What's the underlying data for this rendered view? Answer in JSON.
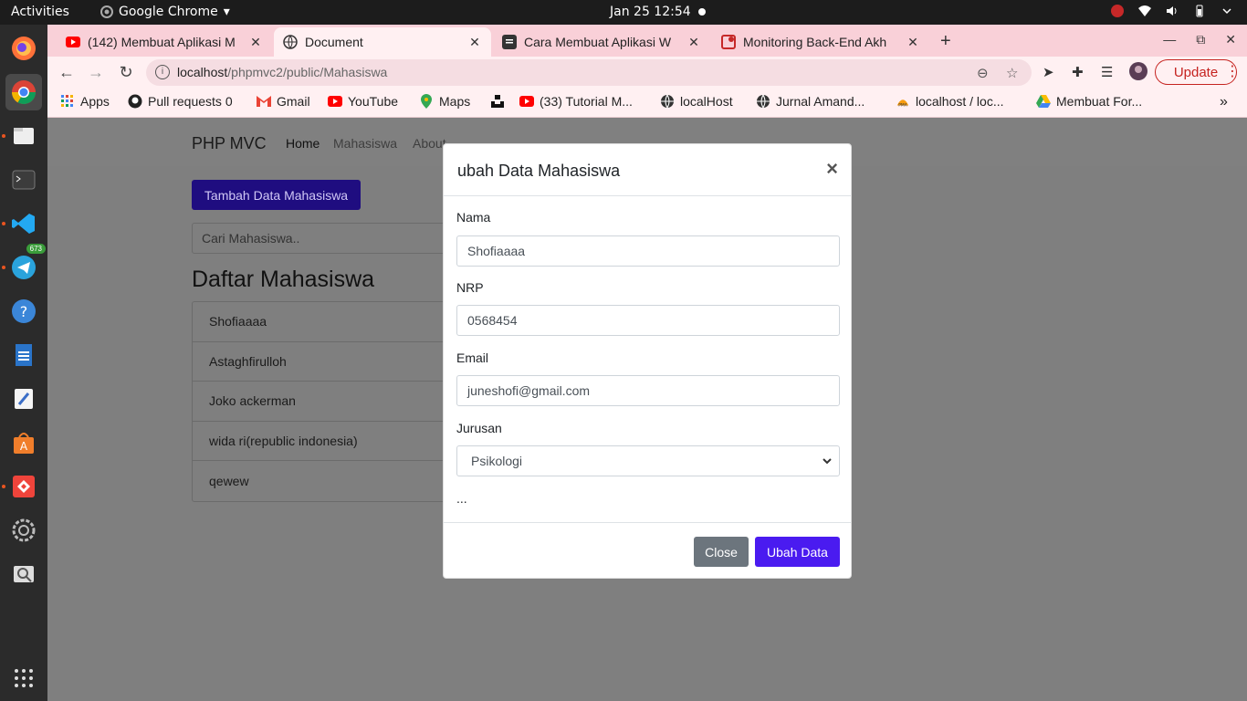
{
  "system": {
    "activities": "Activities",
    "app_name": "Google Chrome",
    "clock": "Jan 25  12:54"
  },
  "dock": {
    "telegram_badge": "673",
    "icons": [
      "firefox-icon",
      "chrome-icon",
      "files-icon",
      "terminal-icon",
      "vscode-icon",
      "telegram-icon",
      "help-icon",
      "libreoffice-writer-icon",
      "text-editor-icon",
      "software-center-icon",
      "anydesk-icon",
      "settings-icon",
      "screenshot-icon",
      "show-apps-icon"
    ]
  },
  "browser": {
    "tabs": [
      {
        "title": "(142) Membuat Aplikasi M",
        "icon": "youtube-icon"
      },
      {
        "title": "Document",
        "icon": "globe-icon",
        "active": true
      },
      {
        "title": "Cara Membuat Aplikasi W",
        "icon": "doc-icon"
      },
      {
        "title": "Monitoring Back-End Akh",
        "icon": "pinned-icon"
      }
    ],
    "url_host": "localhost",
    "url_path": "/phpmvc2/public/Mahasiswa",
    "update_label": "Update",
    "bookmarks": [
      {
        "label": "Apps",
        "icon": "apps-grid-icon"
      },
      {
        "label": "Pull requests 0",
        "icon": "github-icon"
      },
      {
        "label": "Gmail",
        "icon": "gmail-icon"
      },
      {
        "label": "YouTube",
        "icon": "youtube-icon"
      },
      {
        "label": "Maps",
        "icon": "maps-icon"
      },
      {
        "label": "",
        "icon": "unsplash-icon"
      },
      {
        "label": "(33) Tutorial M...",
        "icon": "youtube-icon"
      },
      {
        "label": "localHost",
        "icon": "globe-icon"
      },
      {
        "label": "Jurnal Amand...",
        "icon": "globe-icon"
      },
      {
        "label": "localhost / loc...",
        "icon": "phpmyadmin-icon"
      },
      {
        "label": "Membuat For...",
        "icon": "drive-icon"
      }
    ]
  },
  "page": {
    "brand": "PHP MVC",
    "nav": {
      "home": "Home",
      "mahasiswa": "Mahasiswa",
      "about": "About"
    },
    "add_button": "Tambah Data Mahasiswa",
    "search_placeholder": "Cari Mahasiswa..",
    "list_heading": "Daftar Mahasiswa",
    "students": [
      "Shofiaaaa",
      "Astaghfirulloh",
      "Joko ackerman",
      "wida ri(republic indonesia)",
      "qewew"
    ]
  },
  "modal": {
    "title": "ubah Data Mahasiswa",
    "close_symbol": "×",
    "nama_label": "Nama",
    "nama_value": "Shofiaaaa",
    "nrp_label": "NRP",
    "nrp_value": "0568454",
    "email_label": "Email",
    "email_value": "juneshofi@gmail.com",
    "jurusan_label": "Jurusan",
    "jurusan_value": "Psikologi",
    "ellipsis": "...",
    "close_button": "Close",
    "submit_button": "Ubah Data"
  },
  "colors": {
    "tab_strip": "#f9d0d8",
    "primary_button": "#4a1bf0",
    "secondary_button": "#6c757d",
    "update_accent": "#c5221f"
  }
}
